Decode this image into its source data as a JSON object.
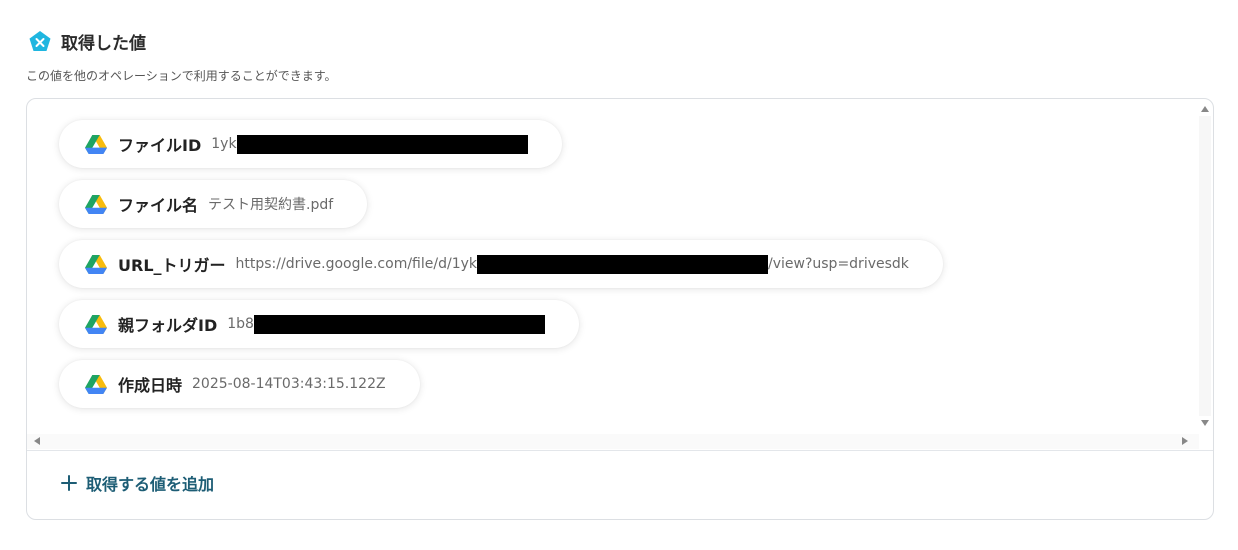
{
  "header": {
    "title": "取得した値",
    "description": "この値を他のオペレーションで利用することができます。"
  },
  "values": [
    {
      "icon": "google-drive-icon",
      "label": "ファイルID",
      "prefix": "1yk",
      "suffix": ""
    },
    {
      "icon": "google-drive-icon",
      "label": "ファイル名",
      "prefix": "テスト用契約書.pdf",
      "suffix": ""
    },
    {
      "icon": "google-drive-icon",
      "label": "URL_トリガー",
      "prefix": "https://drive.google.com/file/d/1yk",
      "suffix": "/view?usp=drivesdk"
    },
    {
      "icon": "google-drive-icon",
      "label": "親フォルダID",
      "prefix": "1b8",
      "suffix": ""
    },
    {
      "icon": "google-drive-icon",
      "label": "作成日時",
      "prefix": "2025-08-14T03:43:15.122Z",
      "suffix": ""
    }
  ],
  "add_button": {
    "label": "取得する値を追加",
    "icon": "plus-icon"
  },
  "colors": {
    "accent": "#1d5d75",
    "header_icon": "#1fb6e0"
  }
}
